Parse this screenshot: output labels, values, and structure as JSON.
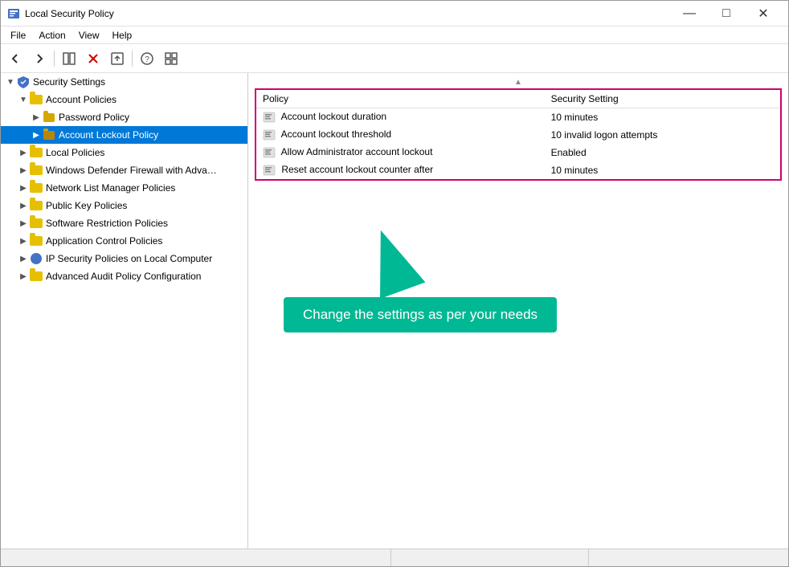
{
  "window": {
    "title": "Local Security Policy",
    "controls": {
      "minimize": "—",
      "maximize": "□",
      "close": "✕"
    }
  },
  "menu": {
    "items": [
      "File",
      "Action",
      "View",
      "Help"
    ]
  },
  "toolbar": {
    "buttons": [
      "◀",
      "▶",
      "⊞",
      "✕",
      "↺",
      "?",
      "⊟"
    ]
  },
  "sidebar": {
    "items": [
      {
        "id": "security-settings",
        "label": "Security Settings",
        "level": 0,
        "expanded": true,
        "type": "root"
      },
      {
        "id": "account-policies",
        "label": "Account Policies",
        "level": 1,
        "expanded": true,
        "type": "folder"
      },
      {
        "id": "password-policy",
        "label": "Password Policy",
        "level": 2,
        "expanded": false,
        "type": "folder-small"
      },
      {
        "id": "account-lockout-policy",
        "label": "Account Lockout Policy",
        "level": 2,
        "expanded": false,
        "type": "folder-small",
        "selected": true
      },
      {
        "id": "local-policies",
        "label": "Local Policies",
        "level": 1,
        "expanded": false,
        "type": "folder"
      },
      {
        "id": "windows-defender",
        "label": "Windows Defender Firewall with Adva…",
        "level": 1,
        "expanded": false,
        "type": "folder"
      },
      {
        "id": "network-list",
        "label": "Network List Manager Policies",
        "level": 1,
        "expanded": false,
        "type": "folder"
      },
      {
        "id": "public-key",
        "label": "Public Key Policies",
        "level": 1,
        "expanded": false,
        "type": "folder"
      },
      {
        "id": "software-restriction",
        "label": "Software Restriction Policies",
        "level": 1,
        "expanded": false,
        "type": "folder"
      },
      {
        "id": "application-control",
        "label": "Application Control Policies",
        "level": 1,
        "expanded": false,
        "type": "folder"
      },
      {
        "id": "ip-security",
        "label": "IP Security Policies on Local Computer",
        "level": 1,
        "expanded": false,
        "type": "ip"
      },
      {
        "id": "advanced-audit",
        "label": "Advanced Audit Policy Configuration",
        "level": 1,
        "expanded": false,
        "type": "folder"
      }
    ]
  },
  "content": {
    "columns": [
      "Policy",
      "Security Setting"
    ],
    "rows": [
      {
        "policy": "Account lockout duration",
        "setting": "10 minutes"
      },
      {
        "policy": "Account lockout threshold",
        "setting": "10 invalid logon attempts"
      },
      {
        "policy": "Allow Administrator account lockout",
        "setting": "Enabled"
      },
      {
        "policy": "Reset account lockout counter after",
        "setting": "10 minutes"
      }
    ]
  },
  "annotation": {
    "text": "Change the settings as per your needs",
    "color": "#00b894"
  },
  "status": {}
}
